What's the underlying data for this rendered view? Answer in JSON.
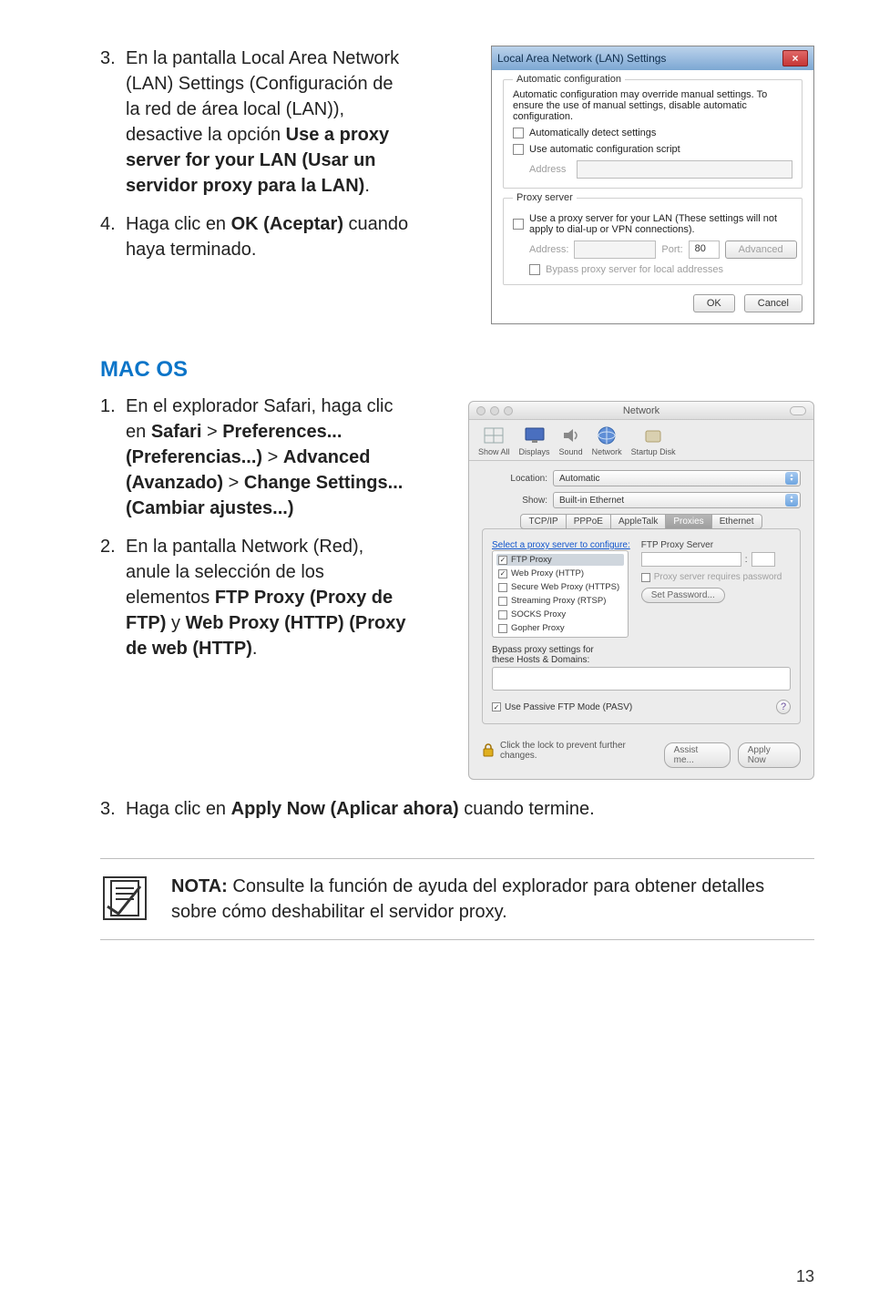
{
  "doc": {
    "step3": {
      "num": "3.",
      "text_a": "En la pantalla Local Area Network (LAN) Settings (Configuración de la red de área local (LAN)), desactive la opción ",
      "bold_a": "Use a proxy server for your LAN (Usar un servidor proxy para la LAN)",
      "dot": "."
    },
    "step4": {
      "num": "4.",
      "text_a": "Haga clic en ",
      "bold_a": "OK (Aceptar)",
      "text_b": " cuando haya terminado."
    },
    "mac_title": "MAC OS",
    "mac1": {
      "num": "1.",
      "text_a": "En el explorador Safari, haga clic en ",
      "bold_a": "Safari",
      "gt1": " > ",
      "bold_b": "Preferences... (Preferencias...)",
      "gt2": " > ",
      "bold_c": "Advanced (Avanzado)",
      "gt3": " > ",
      "bold_d": "Change Settings... (Cambiar ajustes...)"
    },
    "mac2": {
      "num": "2.",
      "text_a": "En la pantalla Network (Red), anule la selección de los elementos ",
      "bold_a": "FTP Proxy (Proxy de FTP)",
      "text_b": " y ",
      "bold_b": "Web Proxy (HTTP) (Proxy de web (HTTP)",
      "dot": "."
    },
    "mac3": {
      "num": "3.",
      "text_a": "Haga clic en ",
      "bold_a": "Apply Now (Aplicar ahora)",
      "text_b": " cuando termine."
    },
    "note": {
      "label": "NOTA:",
      "text": "    Consulte la función de ayuda del explorador para obtener detalles sobre cómo deshabilitar el servidor proxy."
    },
    "page_num": "13"
  },
  "win": {
    "title": "Local Area Network (LAN) Settings",
    "close": "×",
    "section_auto": "Automatic configuration",
    "auto_desc": "Automatic configuration may override manual settings.  To ensure the use of manual settings, disable automatic configuration.",
    "auto_detect": "Automatically detect settings",
    "auto_script": "Use automatic configuration script",
    "address_label": "Address",
    "section_proxy": "Proxy server",
    "proxy_desc": "Use a proxy server for your LAN (These settings will not apply to dial-up or VPN connections).",
    "addr_label": "Address:",
    "port_label": "Port:",
    "port_value": "80",
    "advanced": "Advanced",
    "bypass": "Bypass proxy server for local addresses",
    "ok": "OK",
    "cancel": "Cancel"
  },
  "mac": {
    "title": "Network",
    "toolbar": {
      "show_all": "Show All",
      "displays": "Displays",
      "sound": "Sound",
      "network": "Network",
      "startup": "Startup Disk"
    },
    "location_label": "Location:",
    "location_value": "Automatic",
    "show_label": "Show:",
    "show_value": "Built-in Ethernet",
    "tabs": {
      "tcpip": "TCP/IP",
      "pppoe": "PPPoE",
      "appletalk": "AppleTalk",
      "proxies": "Proxies",
      "ethernet": "Ethernet"
    },
    "select_link": "Select a proxy server to configure:",
    "right_title": "FTP Proxy Server",
    "colon": ":",
    "requires_pw": "Proxy server requires password",
    "set_pw": "Set Password...",
    "list": {
      "ftp": "FTP Proxy",
      "web": "Web Proxy (HTTP)",
      "secure": "Secure Web Proxy (HTTPS)",
      "stream": "Streaming Proxy (RTSP)",
      "socks": "SOCKS Proxy",
      "gopher": "Gopher Proxy"
    },
    "bypass_label": "Bypass proxy settings for\nthese Hosts & Domains:",
    "pasv": "Use Passive FTP Mode (PASV)",
    "help": "?",
    "lock_text": "Click the lock to prevent further changes.",
    "assist": "Assist me...",
    "apply": "Apply Now"
  }
}
